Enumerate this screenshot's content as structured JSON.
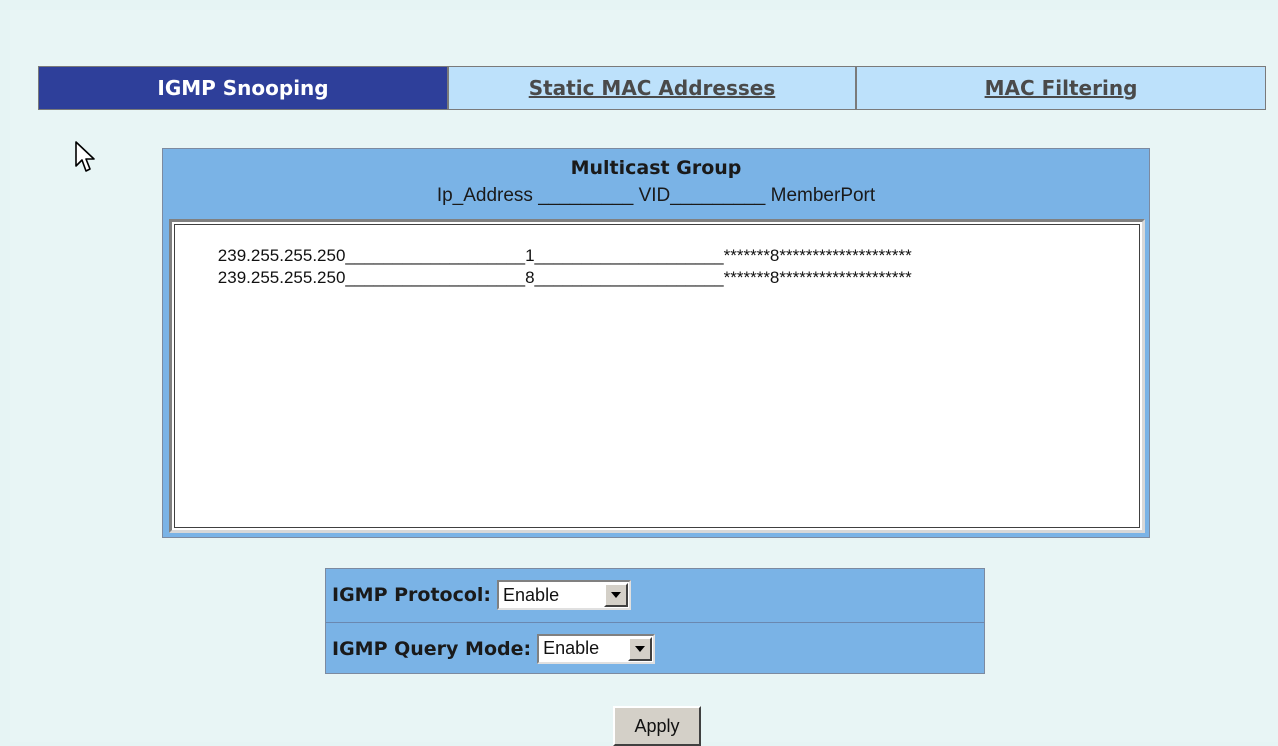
{
  "tabs": [
    {
      "label": "IGMP Snooping",
      "active": true
    },
    {
      "label": "Static MAC Addresses",
      "active": false
    },
    {
      "label": "MAC Filtering",
      "active": false
    }
  ],
  "multicast": {
    "title": "Multicast Group",
    "columns_header": "Ip_Address _________ VID_________ MemberPort",
    "rows": [
      {
        "ip": "239.255.255.250",
        "vid": "1",
        "member_port": "*******8********************"
      },
      {
        "ip": "239.255.255.250",
        "vid": "8",
        "member_port": "*******8********************"
      }
    ]
  },
  "settings": {
    "protocol_label": "IGMP Protocol:",
    "protocol_value": "Enable",
    "query_mode_label": "IGMP Query Mode:",
    "query_mode_value": "Enable"
  },
  "apply_label": "Apply",
  "colors": {
    "active_tab": "#2e3f9a",
    "inactive_tab": "#bde1fb",
    "panel": "#7ab3e6",
    "background": "#e8f5f5"
  },
  "icons": {
    "cursor": "arrow-cursor-icon",
    "dropdown": "chevron-down-icon"
  }
}
